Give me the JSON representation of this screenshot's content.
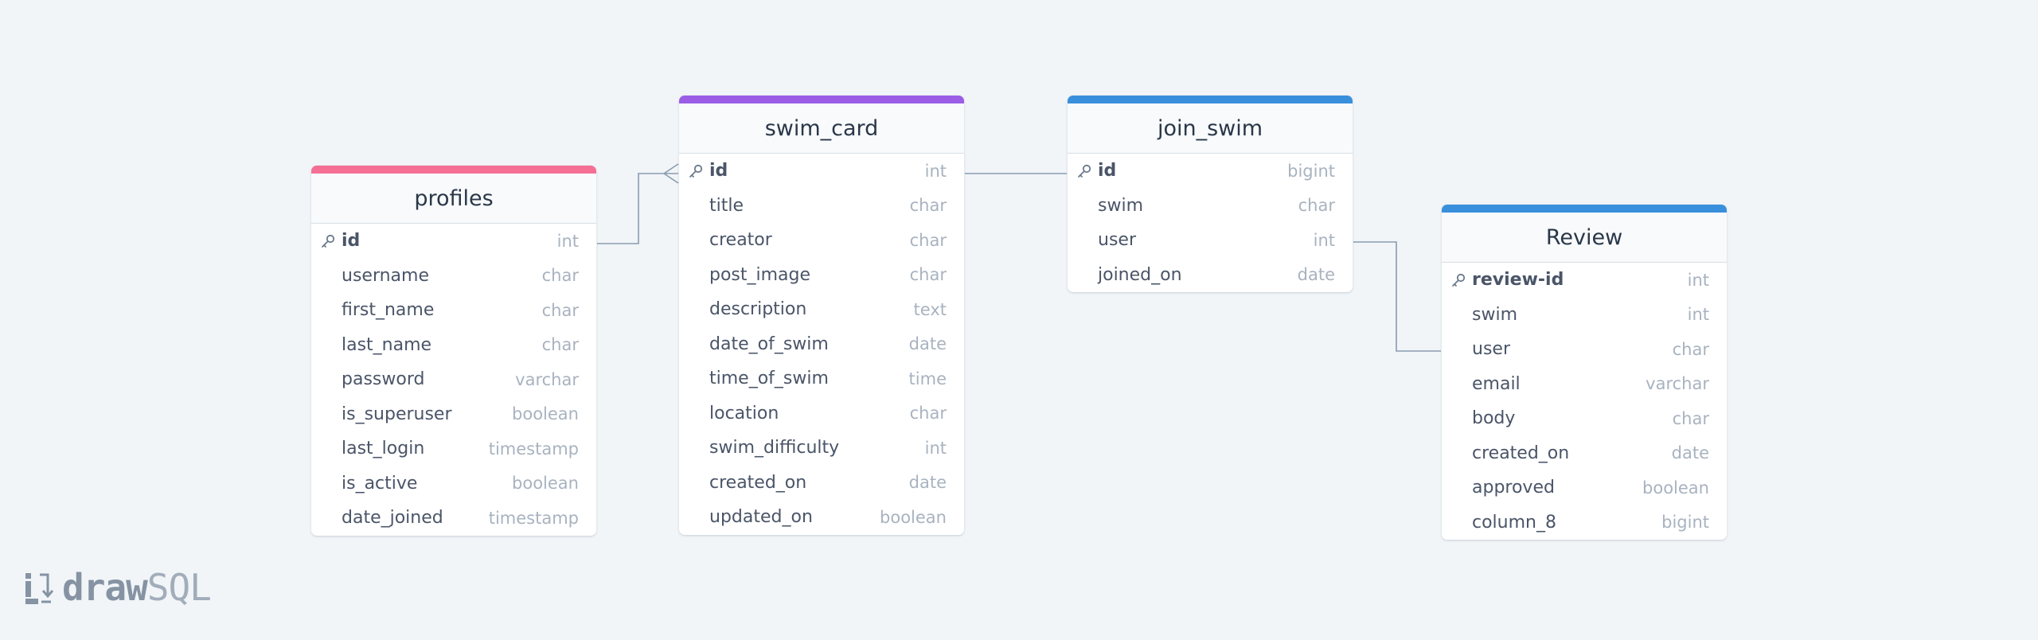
{
  "colors": {
    "profiles": "#f56f94",
    "swim_card": "#9b5de5",
    "join_swim": "#3a8fdc",
    "review": "#3a8fdc",
    "connector": "#8a9bb0"
  },
  "tables": {
    "profiles": {
      "name": "profiles",
      "fields": [
        {
          "name": "id",
          "type": "int",
          "pk": true
        },
        {
          "name": "username",
          "type": "char"
        },
        {
          "name": "first_name",
          "type": "char"
        },
        {
          "name": "last_name",
          "type": "char"
        },
        {
          "name": "password",
          "type": "varchar"
        },
        {
          "name": "is_superuser",
          "type": "boolean"
        },
        {
          "name": "last_login",
          "type": "timestamp"
        },
        {
          "name": "is_active",
          "type": "boolean"
        },
        {
          "name": "date_joined",
          "type": "timestamp"
        }
      ]
    },
    "swim_card": {
      "name": "swim_card",
      "fields": [
        {
          "name": "id",
          "type": "int",
          "pk": true
        },
        {
          "name": "title",
          "type": "char"
        },
        {
          "name": "creator",
          "type": "char"
        },
        {
          "name": "post_image",
          "type": "char"
        },
        {
          "name": "description",
          "type": "text"
        },
        {
          "name": "date_of_swim",
          "type": "date"
        },
        {
          "name": "time_of_swim",
          "type": "time"
        },
        {
          "name": "location",
          "type": "char"
        },
        {
          "name": "swim_difficulty",
          "type": "int"
        },
        {
          "name": "created_on",
          "type": "date"
        },
        {
          "name": "updated_on",
          "type": "boolean"
        }
      ]
    },
    "join_swim": {
      "name": "join_swim",
      "fields": [
        {
          "name": "id",
          "type": "bigint",
          "pk": true
        },
        {
          "name": "swim",
          "type": "char"
        },
        {
          "name": "user",
          "type": "int"
        },
        {
          "name": "joined_on",
          "type": "date"
        }
      ]
    },
    "review": {
      "name": "Review",
      "fields": [
        {
          "name": "review-id",
          "type": "int",
          "pk": true
        },
        {
          "name": "swim",
          "type": "int"
        },
        {
          "name": "user",
          "type": "char"
        },
        {
          "name": "email",
          "type": "varchar"
        },
        {
          "name": "body",
          "type": "char"
        },
        {
          "name": "created_on",
          "type": "date"
        },
        {
          "name": "approved",
          "type": "boolean"
        },
        {
          "name": "column_8",
          "type": "bigint"
        }
      ]
    }
  },
  "relations": [
    {
      "from": "profiles.id",
      "to": "swim_card.id",
      "to_cardinality": "many"
    },
    {
      "from": "swim_card.id",
      "to": "join_swim.id",
      "to_cardinality": "one"
    },
    {
      "from": "join_swim.user",
      "to": "Review.user",
      "to_cardinality": "one"
    }
  ],
  "logo": {
    "part1": "draw",
    "part2": "SQL"
  }
}
